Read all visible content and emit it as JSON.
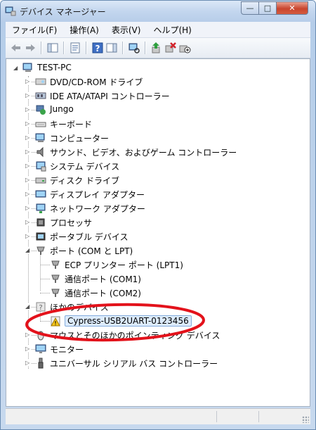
{
  "window": {
    "title": "デバイス マネージャー",
    "controls": {
      "minimize": "—",
      "maximize": "□",
      "close": "✕"
    }
  },
  "menu": [
    "ファイル(F)",
    "操作(A)",
    "表示(V)",
    "ヘルプ(H)"
  ],
  "toolbar_icons": [
    "back-arrow-icon",
    "forward-arrow-icon",
    "show-hide-console-tree-icon",
    "properties-icon",
    "help-icon",
    "show-action-pane-icon",
    "scan-hardware-icon",
    "update-driver-icon",
    "uninstall-icon",
    "disable-icon"
  ],
  "tree": {
    "root": "TEST-PC",
    "items": [
      {
        "label": "DVD/CD-ROM ドライブ",
        "icon": "dvd-drive-icon",
        "expanded": false
      },
      {
        "label": "IDE ATA/ATAPI コントローラー",
        "icon": "ide-controller-icon",
        "expanded": false
      },
      {
        "label": "Jungo",
        "icon": "jungo-device-icon",
        "expanded": false
      },
      {
        "label": "キーボード",
        "icon": "keyboard-icon",
        "expanded": false
      },
      {
        "label": "コンピューター",
        "icon": "computer-icon",
        "expanded": false
      },
      {
        "label": "サウンド、ビデオ、およびゲーム コントローラー",
        "icon": "speaker-icon",
        "expanded": false
      },
      {
        "label": "システム デバイス",
        "icon": "system-device-icon",
        "expanded": false
      },
      {
        "label": "ディスク ドライブ",
        "icon": "disk-drive-icon",
        "expanded": false
      },
      {
        "label": "ディスプレイ アダプター",
        "icon": "display-adapter-icon",
        "expanded": false
      },
      {
        "label": "ネットワーク アダプター",
        "icon": "network-adapter-icon",
        "expanded": false
      },
      {
        "label": "プロセッサ",
        "icon": "processor-icon",
        "expanded": false
      },
      {
        "label": "ポータブル デバイス",
        "icon": "portable-device-icon",
        "expanded": false
      },
      {
        "label": "ポート (COM と LPT)",
        "icon": "port-icon",
        "expanded": true,
        "children": [
          "ECP プリンター ポート (LPT1)",
          "通信ポート (COM1)",
          "通信ポート (COM2)"
        ]
      },
      {
        "label": "ほかのデバイス",
        "icon": "other-devices-icon",
        "expanded": true,
        "children": [
          "Cypress-USB2UART-0123456"
        ]
      },
      {
        "label": "マウスとそのほかのポインティング デバイス",
        "icon": "mouse-icon",
        "expanded": false
      },
      {
        "label": "モニター",
        "icon": "monitor-icon",
        "expanded": false
      },
      {
        "label": "ユニバーサル シリアル バス コントローラー",
        "icon": "usb-icon",
        "expanded": false
      }
    ]
  },
  "selected_item": "Cypress-USB2UART-0123456",
  "colors": {
    "annotation": "#e3121b",
    "selection": "#dcebfc",
    "warning": "#f5c518"
  }
}
